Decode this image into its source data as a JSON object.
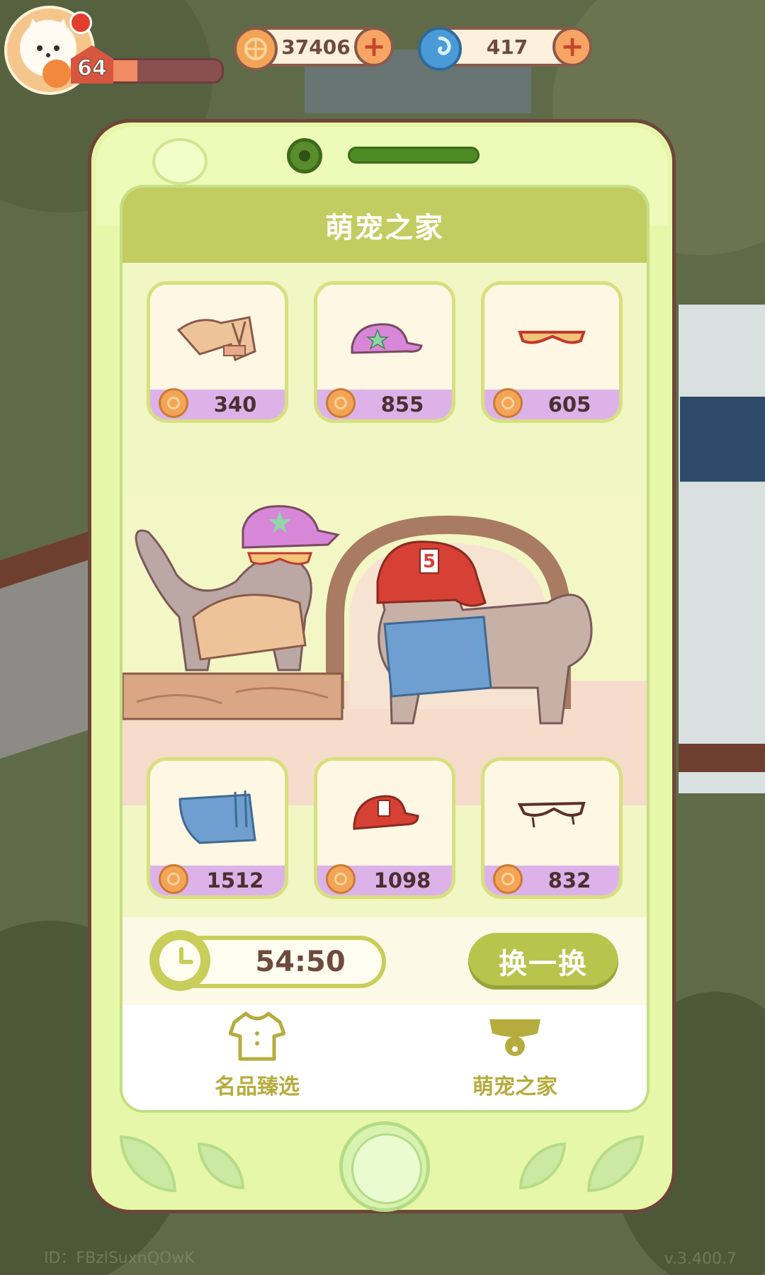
{
  "hud": {
    "level": "64",
    "xp_fraction": 0.3,
    "coins": "37406",
    "gems": "417",
    "coin_icon": "flower-coin-icon",
    "gem_icon": "blue-swirl-icon",
    "plus_icon": "plus-icon"
  },
  "panel": {
    "title": "萌宠之家",
    "top_items": [
      {
        "name": "trench-coat",
        "price": "340"
      },
      {
        "name": "star-cap",
        "price": "855"
      },
      {
        "name": "red-sunglasses",
        "price": "605"
      }
    ],
    "bottom_items": [
      {
        "name": "denim-shirt",
        "price": "1512"
      },
      {
        "name": "red-helmet",
        "price": "1098"
      },
      {
        "name": "black-glasses",
        "price": "832"
      }
    ],
    "timer": "54:50",
    "refresh_label": "换一换",
    "tabs": [
      {
        "label": "名品臻选",
        "icon": "shirt-icon"
      },
      {
        "label": "萌宠之家",
        "icon": "collar-bell-icon"
      }
    ]
  },
  "footer": {
    "id_text": "ID：FBzlSuxnQOwK",
    "version": "v.3.400.7"
  },
  "colors": {
    "phone_body": "#e6f7a9",
    "header": "#c3cc60",
    "price_strip": "#ddb2e8",
    "accent_text": "#b6ac3d"
  }
}
